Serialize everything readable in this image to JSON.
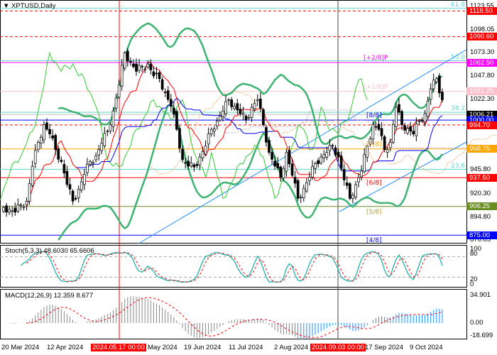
{
  "chart_data": {
    "type": "candlestick",
    "symbol_title": "XPTUSD,Daily",
    "closes": [
      905,
      903,
      900,
      908,
      912,
      950,
      976,
      995,
      985,
      968,
      955,
      930,
      912,
      925,
      941,
      955,
      961,
      975,
      988,
      1010,
      1038,
      1073,
      1063,
      1053,
      1058,
      1061,
      1048,
      1045,
      1030,
      1015,
      990,
      957,
      950,
      949,
      960,
      972,
      990,
      999,
      1010,
      1022,
      1015,
      1007,
      1000,
      1014,
      1022,
      995,
      965,
      950,
      938,
      965,
      940,
      915,
      926,
      938,
      953,
      960,
      965,
      972,
      960,
      935,
      915,
      930,
      945,
      972,
      995,
      990,
      968,
      976,
      1014,
      995,
      991,
      985,
      999,
      1007,
      1034,
      1045,
      1022
    ],
    "price_axis_ticks": [
      "1123.55",
      "1098.05",
      "1073.30",
      "1047.80",
      "1022.30",
      "945.80",
      "920.30",
      "894.80",
      "870.05"
    ],
    "levels": [
      {
        "price": 1118.5,
        "label": "1118.50",
        "color": "#ff0000",
        "style": "dashed",
        "tag": "61.8",
        "tag_color": "#5fd8d0"
      },
      {
        "price": 1090.6,
        "label": "1090.60",
        "color": "#ff0000",
        "style": "dashed",
        "tag": "",
        "tag_color": ""
      },
      {
        "price": 1062.5,
        "label": "1062.50",
        "color": "#ff00ff",
        "style": "solid",
        "tag": "[+2/8]P",
        "tag_color": "#ff00ff"
      },
      {
        "price": 1031.25,
        "label": "1031.25",
        "color": "#ffc0cb",
        "style": "solid",
        "tag": "[+1/8]P",
        "tag_color": "#ffc0cb"
      },
      {
        "price": 1006.21,
        "label": "1006.21",
        "color": "#000000",
        "style": "solid",
        "tag": "",
        "tag_color": ""
      },
      {
        "price": 1000.0,
        "label": "1000.00",
        "color": "#0000ff",
        "style": "solid",
        "tag": "[8/8]",
        "tag_color": "#0000ff"
      },
      {
        "price": 994.7,
        "label": "994.70",
        "color": "#ff0000",
        "style": "dashed",
        "tag": "",
        "tag_color": ""
      },
      {
        "price": 968.75,
        "label": "968.75",
        "color": "#ffa500",
        "style": "solid",
        "tag": "[7/8]",
        "tag_color": "#ffa500"
      },
      {
        "price": 937.5,
        "label": "937.50",
        "color": "#ff0000",
        "style": "solid",
        "tag": "[6/8]",
        "tag_color": "#ff0000"
      },
      {
        "price": 906.25,
        "label": "906.25",
        "color": "#6b8e23",
        "style": "solid",
        "tag": "[5/8]",
        "tag_color": "#b8a030"
      },
      {
        "price": 875.0,
        "label": "875.00",
        "color": "#0000ff",
        "style": "solid",
        "tag": "[4/8]",
        "tag_color": "#0000ff"
      }
    ],
    "fibo": [
      {
        "price": 1121.5,
        "label": "61.8"
      },
      {
        "price": 1064.5,
        "label": "50.0"
      },
      {
        "price": 1008.5,
        "label": "38.2"
      },
      {
        "price": 946.5,
        "label": "23.6"
      }
    ],
    "stoch": {
      "label": "Stoch(5,3,3) 48.6030 65.6606",
      "ticks": [
        "100",
        "80",
        "20",
        "0"
      ]
    },
    "macd": {
      "label": "MACD(12,26,9) 12.359 8.677",
      "ticks": [
        "34.901",
        "0.00",
        "-18.699"
      ],
      "max": 34.901,
      "min": -18.699
    },
    "time_labels": [
      "20 Mar 2024",
      "12 Apr 2024",
      "2024.05.17 00:00",
      "May 2024",
      "19 Jun 2024",
      "11 Jul 2024",
      "2 Aug 2024",
      "2024.09.03 00:00",
      "17 Sep 2024",
      "9 Oct 2024"
    ],
    "colors": {
      "bull": "#ffffff",
      "bear": "#000000",
      "bollinger": "#3cb371",
      "tenkan": "#ff0000",
      "kijun": "#0000ff",
      "chikou": "#32cd32",
      "signal": "#ff0000",
      "macd": "#1e90ff",
      "stoch_main": "#20b2aa"
    }
  }
}
